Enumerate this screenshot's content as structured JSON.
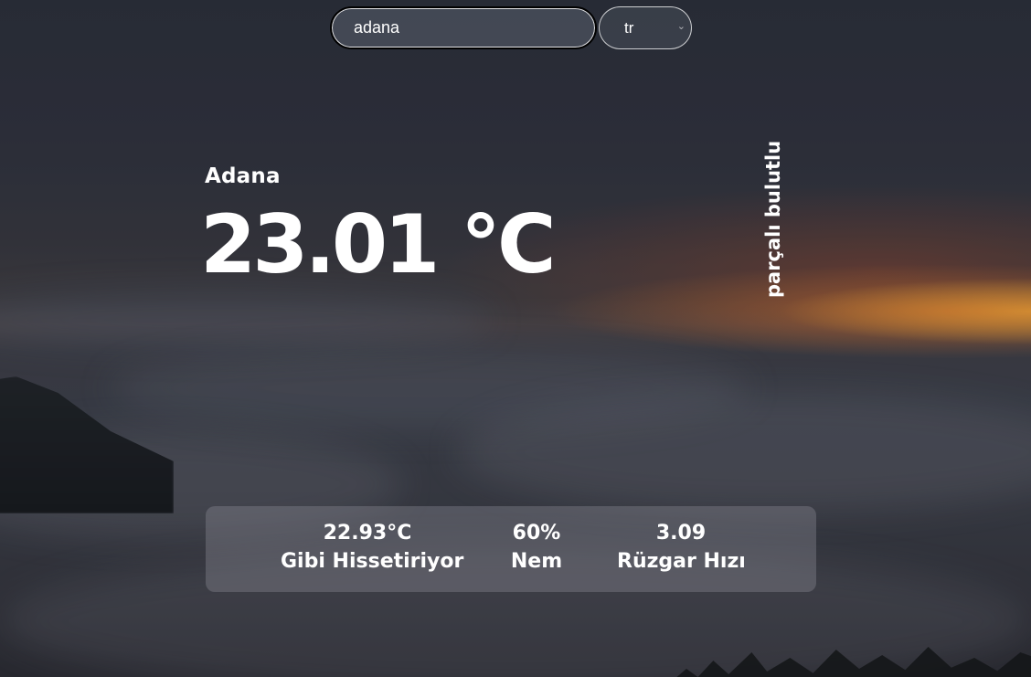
{
  "search": {
    "value": "adana",
    "language_selected": "tr"
  },
  "weather": {
    "city": "Adana",
    "temperature": "23.01 °C",
    "description": "parçalı bulutlu"
  },
  "stats": {
    "feels_like_value": "22.93°C",
    "feels_like_label": "Gibi Hissetiriyor",
    "humidity_value": "60%",
    "humidity_label": "Nem",
    "wind_value": "3.09",
    "wind_label": "Rüzgar Hızı"
  },
  "icons": {
    "select_chevron": "chevron-down-icon"
  },
  "colors": {
    "text": "#ffffff",
    "panel": "rgba(140,140,150,0.38)",
    "sunset_accent": "#ff8228"
  }
}
